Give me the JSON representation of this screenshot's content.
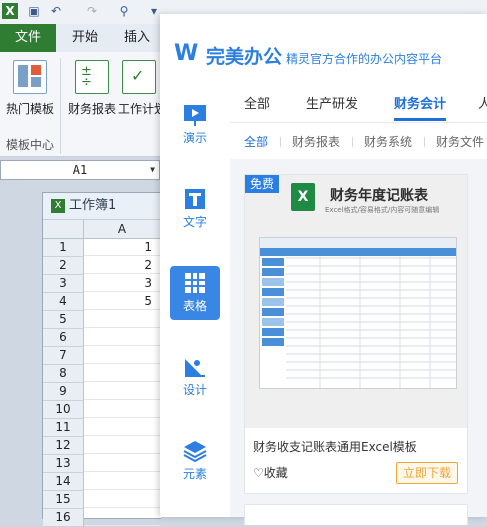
{
  "excel": {
    "ribbon_tabs": [
      "文件",
      "开始",
      "插入"
    ],
    "ribbon_buttons": [
      "热门模板",
      "财务报表",
      "工作计划"
    ],
    "group_label": "模板中心",
    "name_box": "A1",
    "workbook_title": "工作簿1",
    "column_header": "A",
    "row_numbers": [
      "1",
      "2",
      "3",
      "4",
      "5",
      "6",
      "7",
      "8",
      "9",
      "10",
      "11",
      "12",
      "13",
      "14",
      "15",
      "16"
    ],
    "cells": [
      "1",
      "2",
      "3",
      "5"
    ]
  },
  "panel": {
    "logo_text": "完美办公",
    "tagline": "精灵官方合作的办公内容平台",
    "nav": [
      {
        "label": "演示",
        "icon": "presentation-icon"
      },
      {
        "label": "文字",
        "icon": "text-icon"
      },
      {
        "label": "表格",
        "icon": "table-icon",
        "active": true
      },
      {
        "label": "设计",
        "icon": "design-icon"
      },
      {
        "label": "元素",
        "icon": "elements-icon"
      }
    ],
    "tabs": [
      "全部",
      "生产研发",
      "财务会计",
      "人"
    ],
    "active_tab": "财务会计",
    "subtabs": [
      "全部",
      "财务报表",
      "财务系统",
      "财务文件"
    ],
    "active_subtab": "全部",
    "card": {
      "badge": "免费",
      "doc_title": "财务年度记账表",
      "doc_subtitle": "Excel格式/容易格式/内容可随意编辑",
      "name": "财务收支记账表通用Excel模板",
      "fav_label": "收藏",
      "download_label": "立即下载"
    },
    "accent_color": "#2b7fe0"
  }
}
